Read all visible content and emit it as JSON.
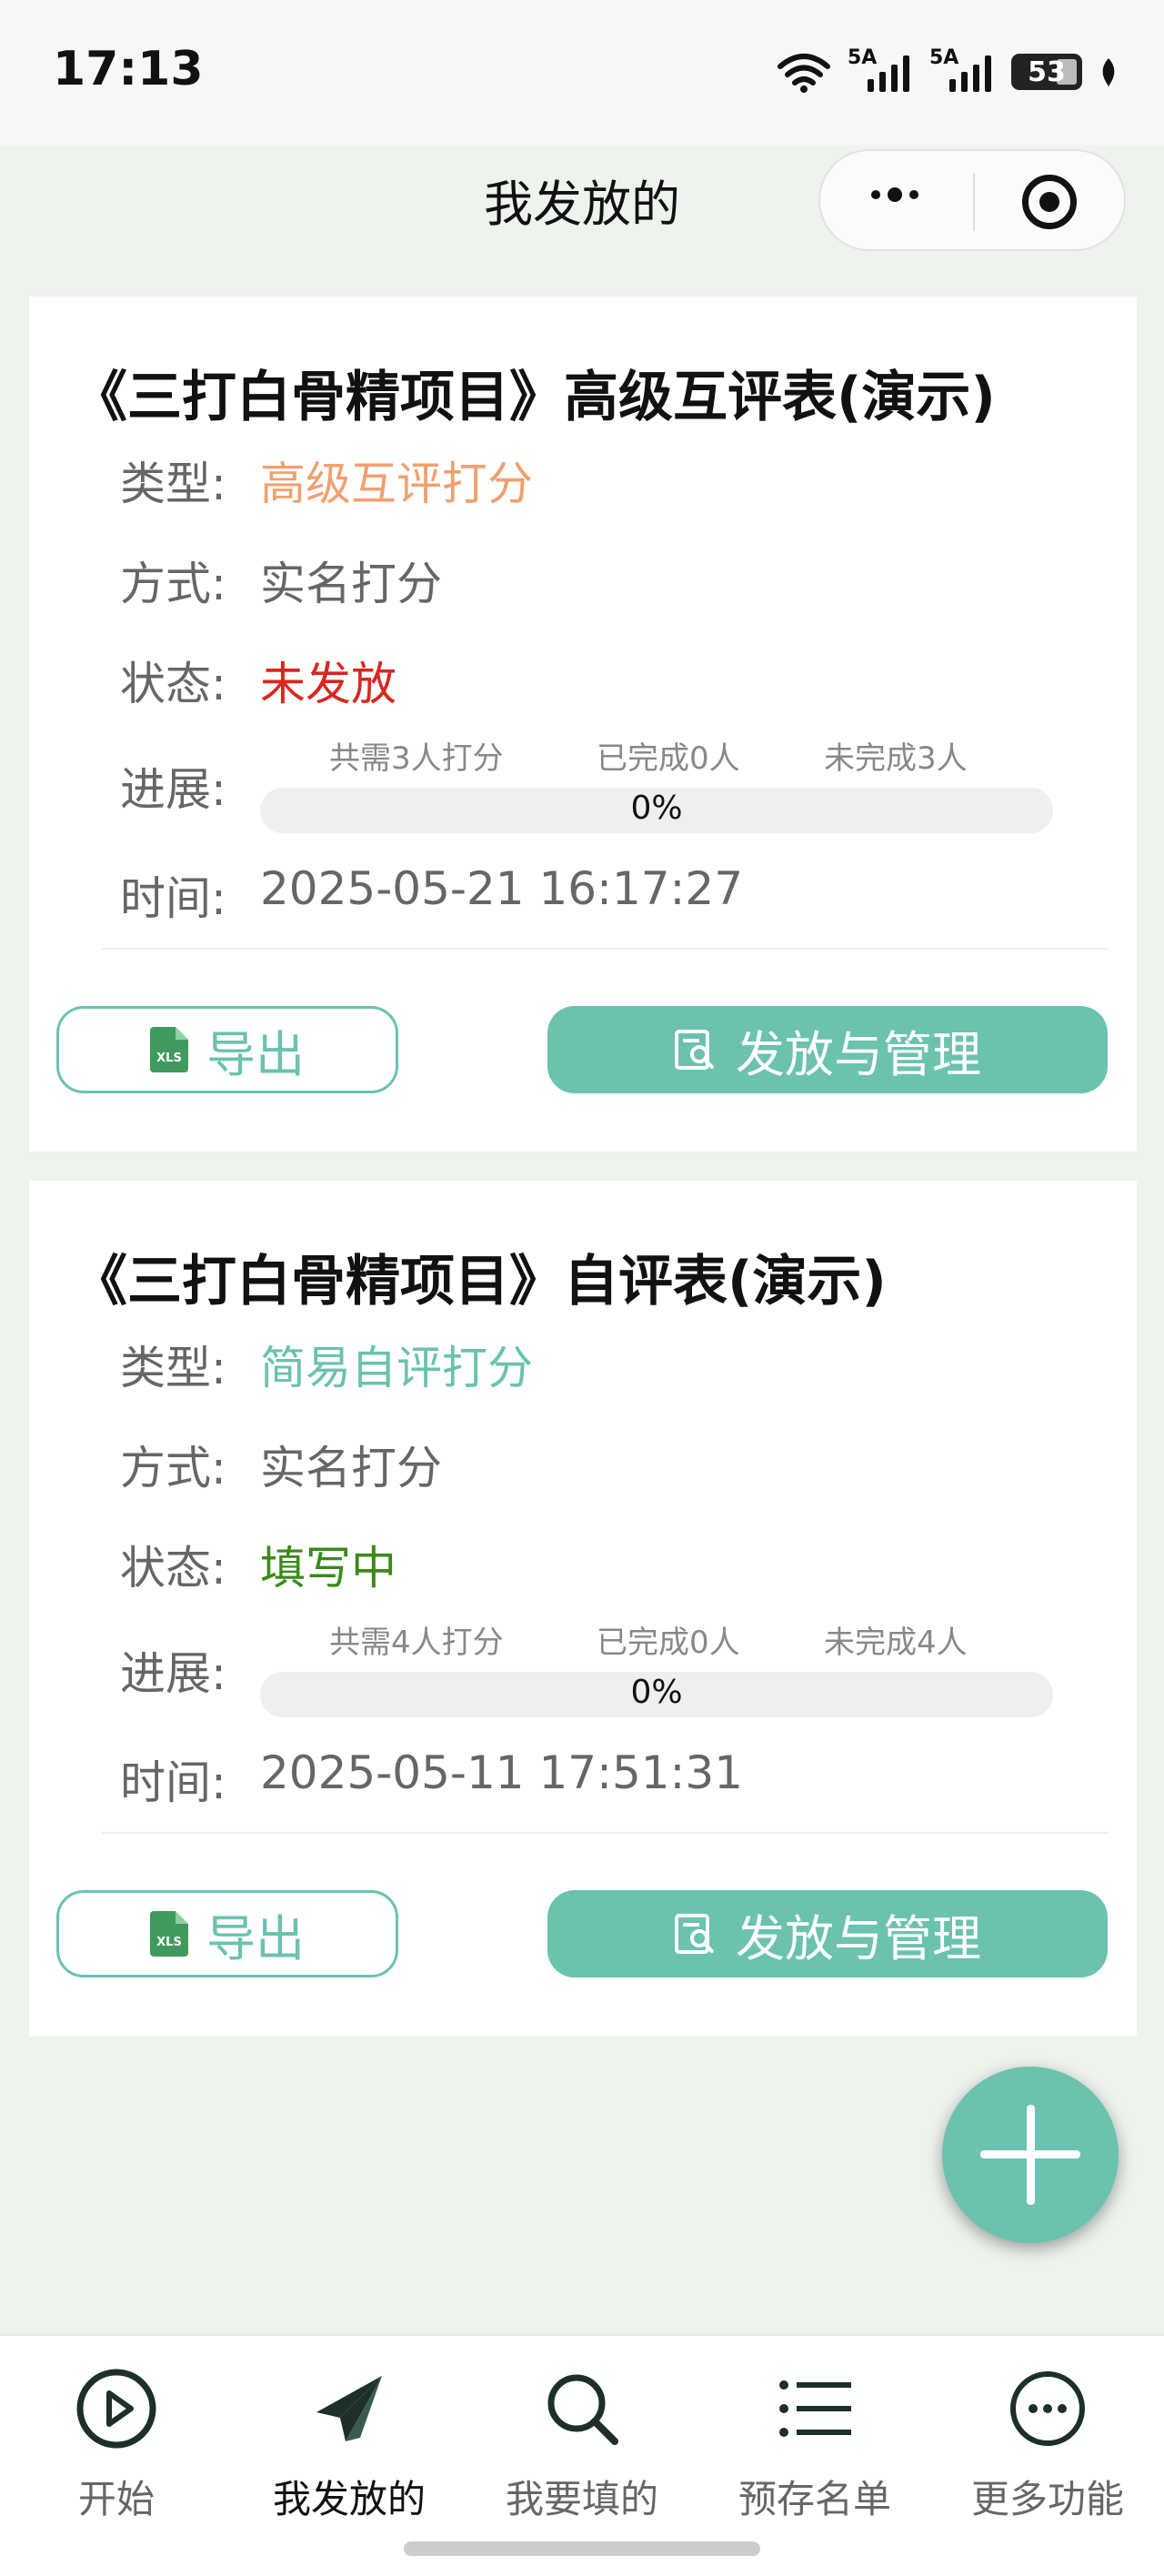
{
  "status_bar": {
    "time": "17:13",
    "signal1_label": "5A",
    "signal2_label": "5A",
    "battery": "53"
  },
  "header": {
    "title": "我发放的"
  },
  "colors": {
    "accent": "#6ac2af",
    "type_orange": "#f0a070",
    "status_red": "#d9271f",
    "status_green": "#3a8a1a"
  },
  "labels": {
    "type": "类型:",
    "method": "方式:",
    "status": "状态:",
    "progress": "进展:",
    "time": "时间:",
    "export": "导出",
    "manage": "发放与管理"
  },
  "cards": [
    {
      "title": "《三打白骨精项目》高级互评表(演示)",
      "type": "高级互评打分",
      "method": "实名打分",
      "status": "未发放",
      "progress_total": "共需3人打分",
      "progress_done": "已完成0人",
      "progress_todo": "未完成3人",
      "progress_percent": "0%",
      "progress_fraction": 0,
      "time": "2025-05-21 16:17:27"
    },
    {
      "title": "《三打白骨精项目》自评表(演示)",
      "type": "简易自评打分",
      "method": "实名打分",
      "status": "填写中",
      "progress_total": "共需4人打分",
      "progress_done": "已完成0人",
      "progress_todo": "未完成4人",
      "progress_percent": "0%",
      "progress_fraction": 0,
      "time": "2025-05-11 17:51:31"
    }
  ],
  "tabbar": {
    "items": [
      {
        "label": "开始",
        "icon": "play-circle-icon"
      },
      {
        "label": "我发放的",
        "icon": "paper-plane-icon"
      },
      {
        "label": "我要填的",
        "icon": "search-icon"
      },
      {
        "label": "预存名单",
        "icon": "list-icon"
      },
      {
        "label": "更多功能",
        "icon": "more-circle-icon"
      }
    ],
    "active_index": 1
  }
}
